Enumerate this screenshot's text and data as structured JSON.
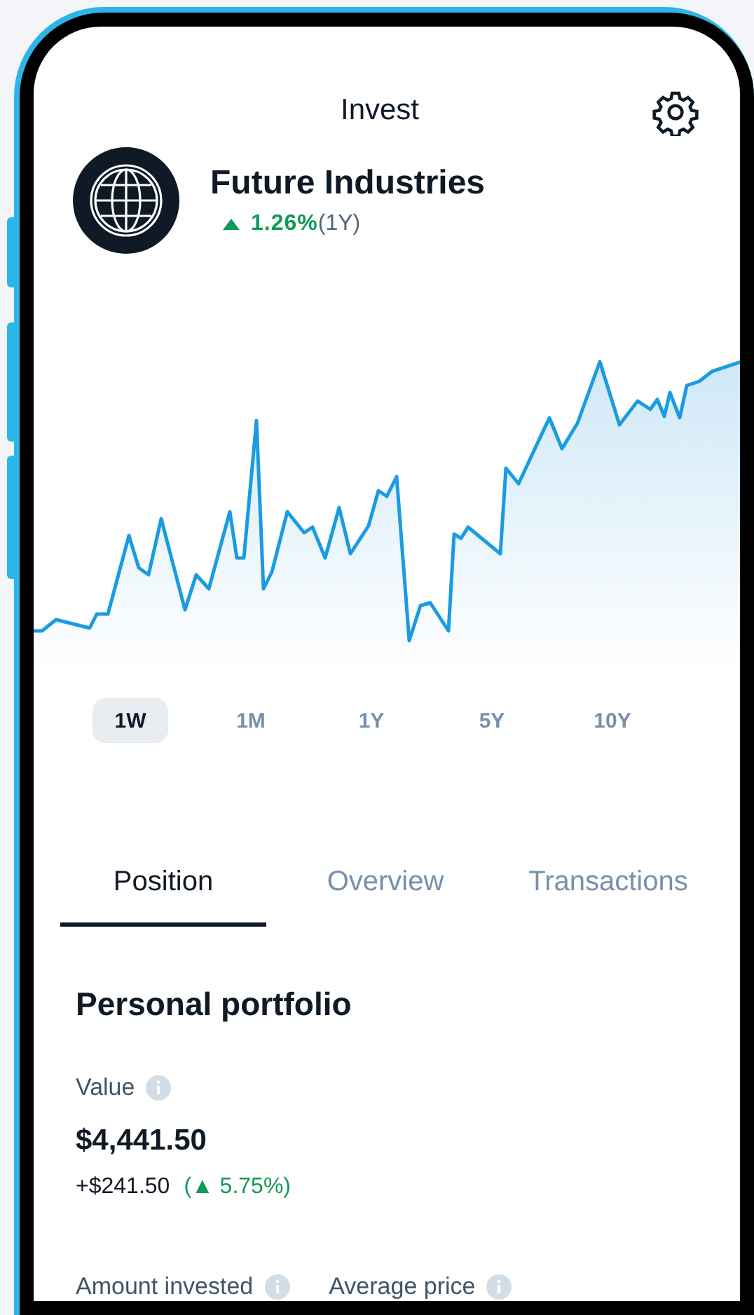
{
  "header": {
    "title": "Invest"
  },
  "asset": {
    "name": "Future Industries",
    "change": "1.26%",
    "period": "(1Y)",
    "rising": true
  },
  "ranges": [
    {
      "label": "1W",
      "selected": true
    },
    {
      "label": "1M",
      "selected": false
    },
    {
      "label": "1Y",
      "selected": false
    },
    {
      "label": "5Y",
      "selected": false
    },
    {
      "label": "10Y",
      "selected": false
    }
  ],
  "tabs": [
    {
      "label": "Position",
      "selected": true
    },
    {
      "label": "Overview",
      "selected": false
    },
    {
      "label": "Transactions",
      "selected": false
    }
  ],
  "portfolio": {
    "heading": "Personal portfolio",
    "value_label": "Value",
    "value": "$4,441.50",
    "change_amount": "+$241.50",
    "change_percent": "(▲ 5.75%)",
    "fields": [
      {
        "label": "Amount invested"
      },
      {
        "label": "Average price"
      }
    ]
  }
}
